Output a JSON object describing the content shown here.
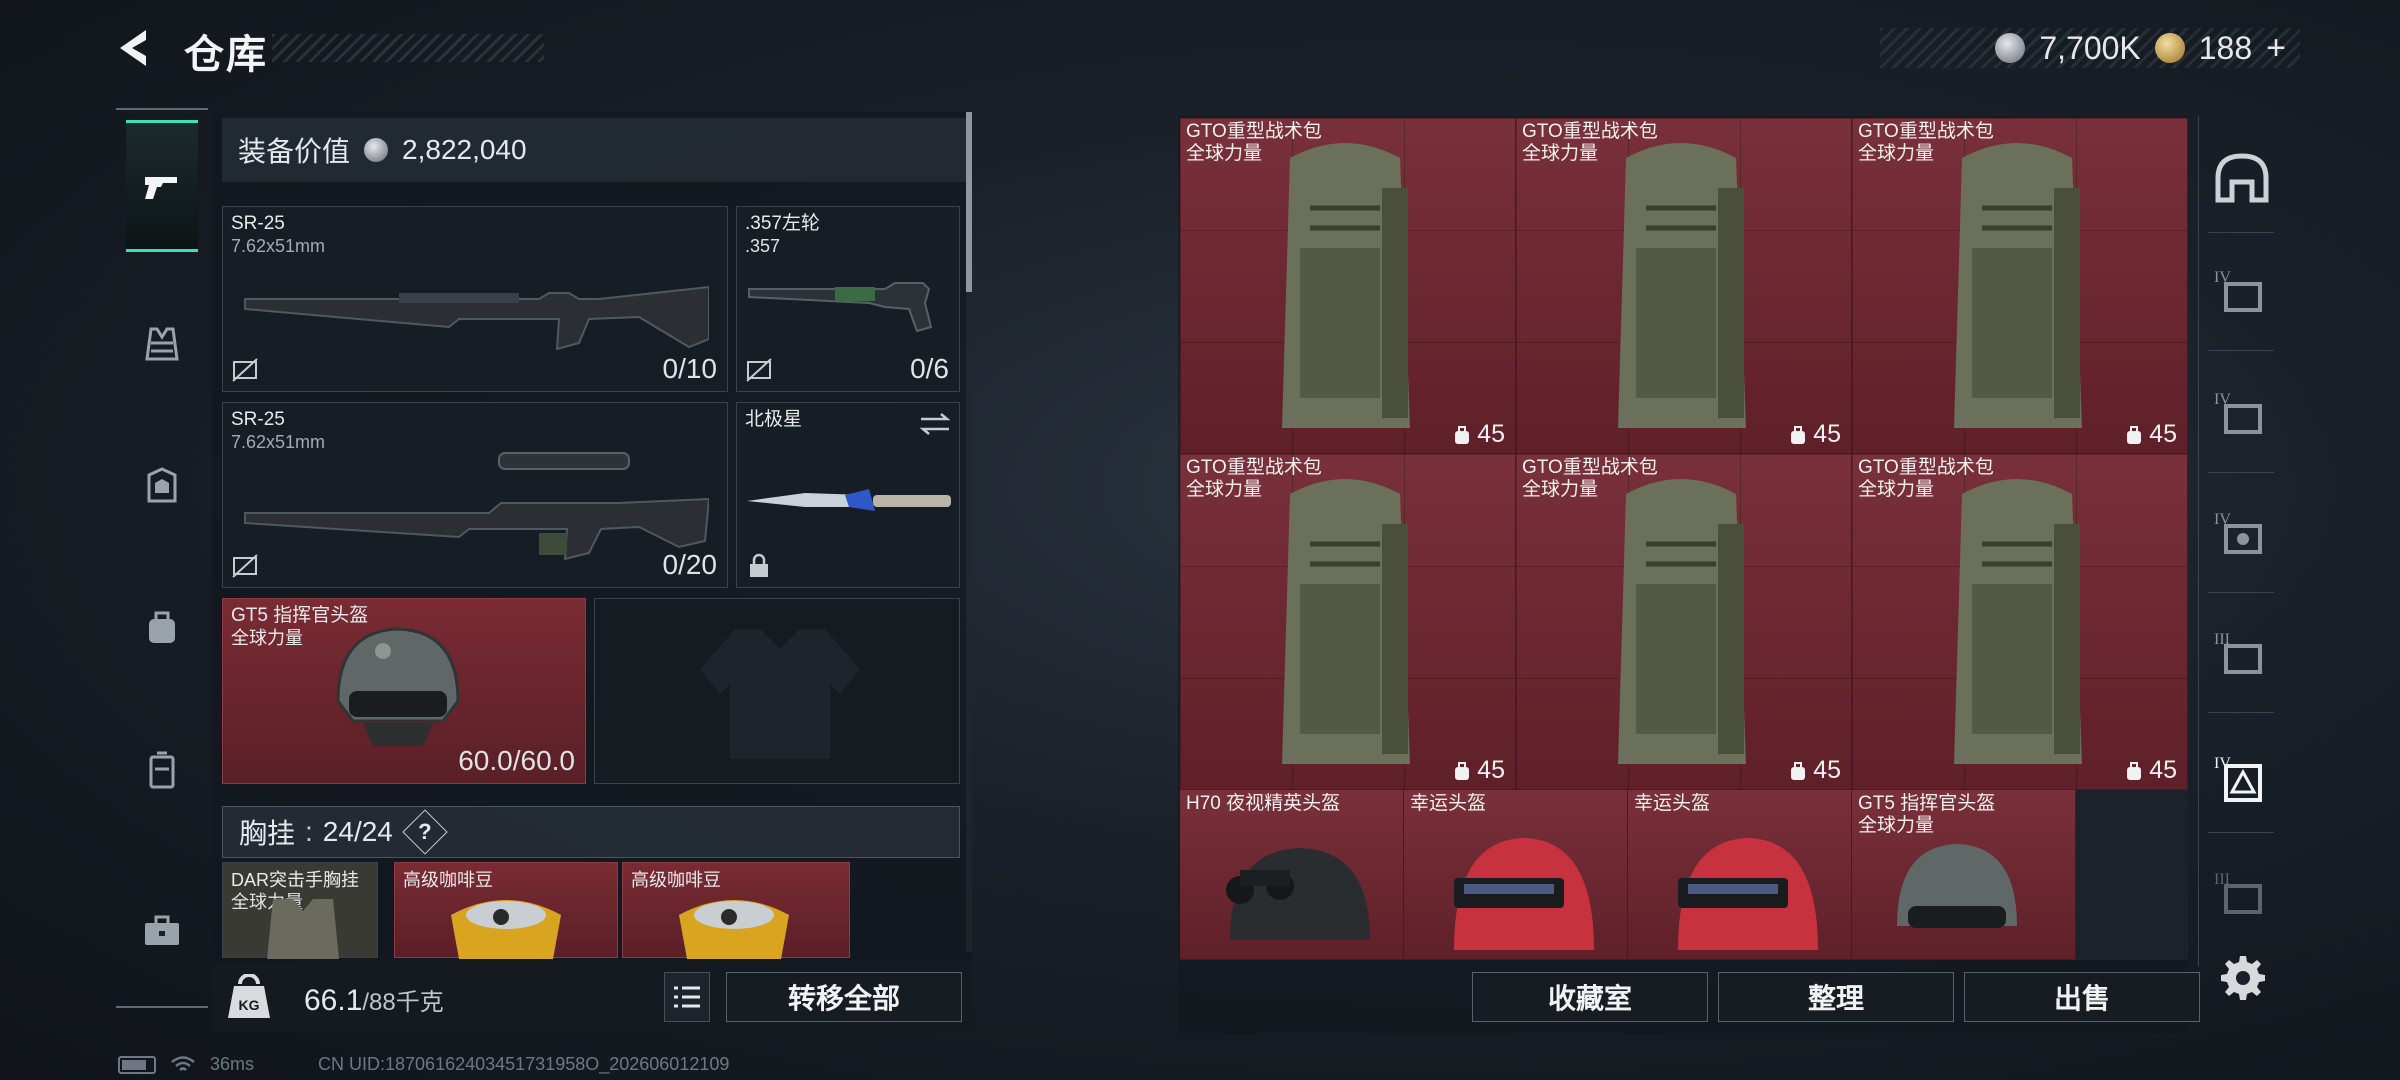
{
  "header": {
    "title": "仓库",
    "currency_silver": "7,700K",
    "currency_gold": "188",
    "gold_plus": "+"
  },
  "left_nav": {
    "items": [
      {
        "icon": "pistol-icon",
        "active": true
      },
      {
        "icon": "vest-icon"
      },
      {
        "icon": "backpack-armor-icon"
      },
      {
        "icon": "backpack-icon"
      },
      {
        "icon": "case-icon"
      },
      {
        "icon": "toolbox-icon"
      }
    ]
  },
  "equipment": {
    "value_label": "装备价值",
    "value": "2,822,040",
    "primary_weapon_1": {
      "name": "SR-25",
      "caliber": "7.62x51mm",
      "ammo": "0/10"
    },
    "secondary_weapon": {
      "name": ".357左轮",
      "caliber": ".357",
      "ammo": "0/6"
    },
    "primary_weapon_2": {
      "name": "SR-25",
      "caliber": "7.62x51mm",
      "ammo": "0/20"
    },
    "melee": {
      "name": "北极星"
    },
    "helmet": {
      "name": "GT5 指挥官头盔",
      "faction": "全球力量",
      "durability": "60.0/60.0"
    },
    "chest_rig": {
      "label": "胸挂",
      "capacity": "24/24",
      "help": "?"
    },
    "chest_items": [
      {
        "name": "DAR突击手胸挂",
        "sub": "全球力量"
      },
      {
        "name": "高级咖啡豆"
      },
      {
        "name": "高级咖啡豆"
      }
    ]
  },
  "bottom_left": {
    "weight_current": "66.1",
    "weight_max": "/88千克",
    "transfer_all": "转移全部"
  },
  "storage": {
    "backpacks": [
      {
        "name": "GTO重型战术包",
        "faction": "全球力量",
        "capacity": "45"
      },
      {
        "name": "GTO重型战术包",
        "faction": "全球力量",
        "capacity": "45"
      },
      {
        "name": "GTO重型战术包",
        "faction": "全球力量",
        "capacity": "45"
      },
      {
        "name": "GTO重型战术包",
        "faction": "全球力量",
        "capacity": "45"
      },
      {
        "name": "GTO重型战术包",
        "faction": "全球力量",
        "capacity": "45"
      },
      {
        "name": "GTO重型战术包",
        "faction": "全球力量",
        "capacity": "45"
      }
    ],
    "helmets": [
      {
        "name": "H70 夜视精英头盔"
      },
      {
        "name": "幸运头盔"
      },
      {
        "name": "幸运头盔"
      },
      {
        "name": "GT5 指挥官头盔",
        "faction": "全球力量"
      }
    ],
    "buttons": {
      "collection": "收藏室",
      "organize": "整理",
      "sell": "出售"
    }
  },
  "right_nav": {
    "items": [
      "home-icon",
      "tier-4-icon",
      "tier-4-icon",
      "tier-4-icon",
      "tier-3-icon",
      "tier-4-icon",
      "tier-3-icon"
    ]
  },
  "status": {
    "ping": "36ms",
    "uid": "CN UID:18706162403451731958O_202606012109"
  },
  "colors": {
    "accent": "#3be0b4",
    "storage_red": "#79303a"
  }
}
